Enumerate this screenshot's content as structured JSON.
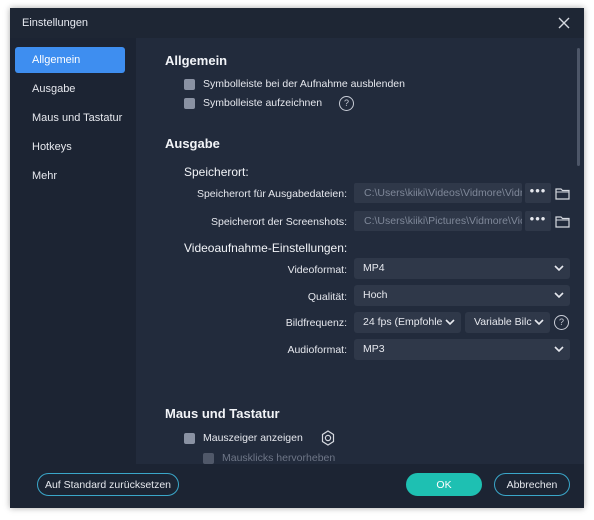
{
  "window": {
    "title": "Einstellungen"
  },
  "sidebar": {
    "items": [
      {
        "label": "Allgemein",
        "active": true
      },
      {
        "label": "Ausgabe",
        "active": false
      },
      {
        "label": "Maus und Tastatur",
        "active": false
      },
      {
        "label": "Hotkeys",
        "active": false
      },
      {
        "label": "Mehr",
        "active": false
      }
    ]
  },
  "general": {
    "heading": "Allgemein",
    "hide_toolbar_label": "Symbolleiste bei der Aufnahme ausblenden",
    "record_toolbar_label": "Symbolleiste aufzeichnen"
  },
  "output": {
    "heading": "Ausgabe",
    "storage_heading": "Speicherort:",
    "output_files_label": "Speicherort für Ausgabedateien:",
    "output_files_path": "C:\\Users\\kiiki\\Videos\\Vidmore\\Vidm",
    "screenshots_label": "Speicherort der Screenshots:",
    "screenshots_path": "C:\\Users\\kiiki\\Pictures\\Vidmore\\Vic",
    "dots": "•••",
    "video_settings_heading": "Videoaufnahme-Einstellungen:",
    "format_label": "Videoformat:",
    "format_value": "MP4",
    "quality_label": "Qualität:",
    "quality_value": "Hoch",
    "framerate_label": "Bildfrequenz:",
    "framerate_value": "24 fps (Empfohle",
    "bitrate_value": "Variable Bilc",
    "audio_label": "Audioformat:",
    "audio_value": "MP3"
  },
  "mouse": {
    "heading": "Maus und Tastatur",
    "show_cursor_label": "Mauszeiger anzeigen",
    "highlight_clicks_label": "Mausklicks hervorheben"
  },
  "footer": {
    "reset_label": "Auf Standard zurücksetzen",
    "ok_label": "OK",
    "cancel_label": "Abbrechen"
  },
  "colors": {
    "accent": "#3e8ef0",
    "ok": "#1ec0b2",
    "background": "#222b3c"
  }
}
